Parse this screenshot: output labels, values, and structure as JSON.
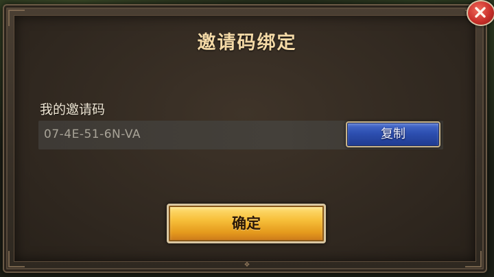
{
  "dialog": {
    "title": "邀请码绑定",
    "my_code_label": "我的邀请码",
    "code_value": "07-4E-51-6N-VA",
    "copy_label": "复制",
    "confirm_label": "确定"
  },
  "icons": {
    "close": "close-icon",
    "ornament": "ornament-icon"
  },
  "colors": {
    "title": "#f4d9a6",
    "copy_button": "#2d4fb0",
    "confirm_button": "#f7bf3a",
    "close_button": "#c9302a"
  }
}
